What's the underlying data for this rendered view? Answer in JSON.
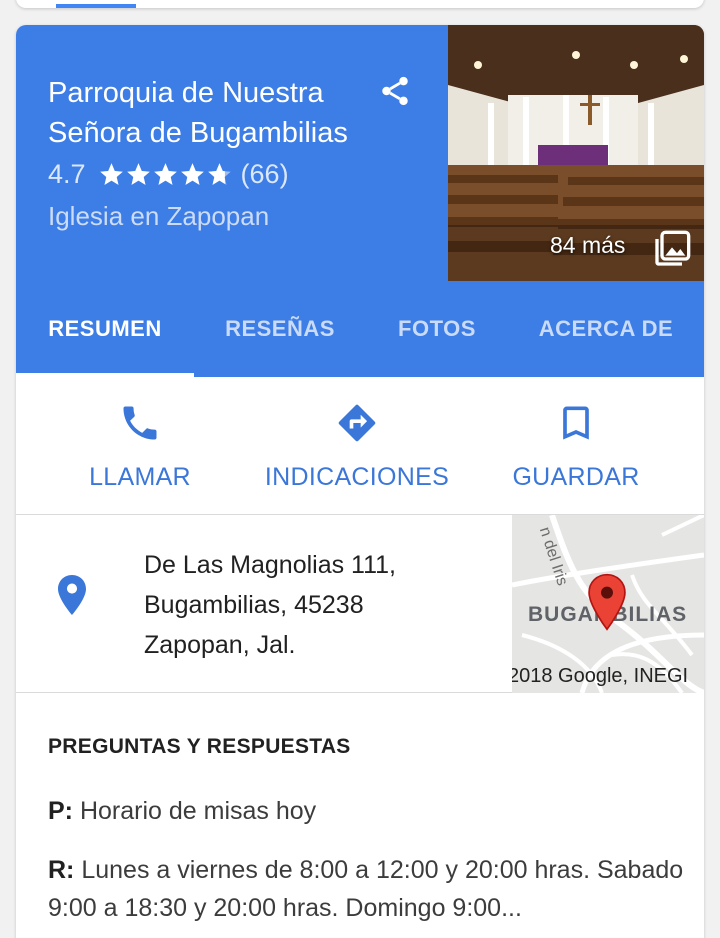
{
  "place": {
    "name": "Parroquia de Nuestra Señora de Bugambilias",
    "rating": "4.7",
    "stars": 4.7,
    "reviews": "(66)",
    "category": "Iglesia en Zapopan"
  },
  "photos": {
    "count_label": "84 más"
  },
  "icons": {
    "share": "share-icon",
    "gallery": "photo-library-icon",
    "phone": "phone-icon",
    "directions": "directions-icon",
    "save": "bookmark-icon",
    "pin": "location-pin-icon",
    "map_marker": "map-marker-icon"
  },
  "tabs": [
    {
      "label": "RESUMEN",
      "active": true
    },
    {
      "label": "RESEÑAS",
      "active": false
    },
    {
      "label": "FOTOS",
      "active": false
    },
    {
      "label": "ACERCA DE",
      "active": false
    }
  ],
  "actions": [
    {
      "label": "LLAMAR"
    },
    {
      "label": "INDICACIONES"
    },
    {
      "label": "GUARDAR"
    }
  ],
  "address": {
    "line1": "De Las Magnolias 111,",
    "line2": "Bugambilias, 45238",
    "line3": "Zapopan, Jal."
  },
  "map": {
    "area_label": "BUGAMBILIAS",
    "road_label": "n del Iris",
    "copyright": "2018 Google, INEGI"
  },
  "qa": {
    "heading": "PREGUNTAS Y RESPUESTAS",
    "q_prefix": "P:",
    "question": " Horario de misas hoy",
    "a_prefix": "R:",
    "answer": " Lunes a viernes de 8:00 a 12:00 y 20:00 hras. Sabado 9:00 a 18:30 y 20:00 hras. Domingo 9:00..."
  },
  "colors": {
    "header_blue": "#3d7de6",
    "action_blue": "#3b77d8",
    "marker_red": "#ea4335"
  }
}
